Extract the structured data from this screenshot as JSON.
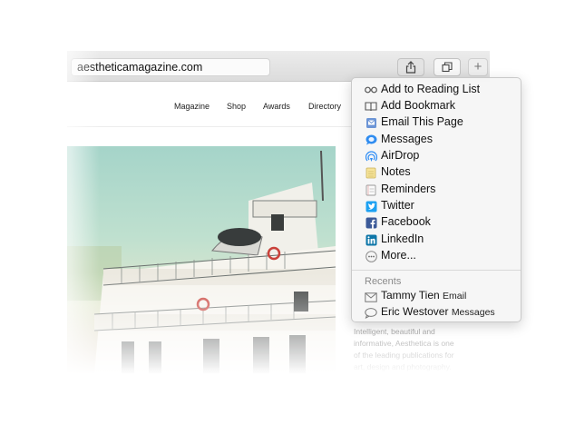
{
  "browser": {
    "address": "aestheticamagazine.com",
    "toolbar": {
      "share_icon": "share-icon",
      "tabs_icon": "tab-overview-icon",
      "new_tab_label": "+"
    }
  },
  "site": {
    "nav": [
      "Magazine",
      "Shop",
      "Awards",
      "Directory"
    ],
    "article_lines": [
      "Intelligent, beautiful and",
      "informative, Aesthetica is one",
      "of the leading publications for",
      "art, design and photography."
    ]
  },
  "share_menu": {
    "items": [
      {
        "label": "Add to Reading List",
        "icon": "reading-list-icon"
      },
      {
        "label": "Add Bookmark",
        "icon": "bookmark-book-icon"
      },
      {
        "label": "Email This Page",
        "icon": "mail-icon"
      },
      {
        "label": "Messages",
        "icon": "messages-icon"
      },
      {
        "label": "AirDrop",
        "icon": "airdrop-icon"
      },
      {
        "label": "Notes",
        "icon": "notes-icon"
      },
      {
        "label": "Reminders",
        "icon": "reminders-icon"
      },
      {
        "label": "Twitter",
        "icon": "twitter-icon"
      },
      {
        "label": "Facebook",
        "icon": "facebook-icon"
      },
      {
        "label": "LinkedIn",
        "icon": "linkedin-icon"
      },
      {
        "label": "More...",
        "icon": "more-icon"
      }
    ],
    "recents_label": "Recents",
    "recents": [
      {
        "name": "Tammy Tien",
        "service": "Email",
        "icon": "envelope-icon"
      },
      {
        "name": "Eric Westover",
        "service": "Messages",
        "icon": "speech-bubble-icon"
      }
    ]
  },
  "colors": {
    "twitter": "#1da1f2",
    "facebook": "#3b5998",
    "linkedin": "#0e76a8",
    "messages": "#2f8cf0",
    "airdrop": "#2b8bf5"
  }
}
